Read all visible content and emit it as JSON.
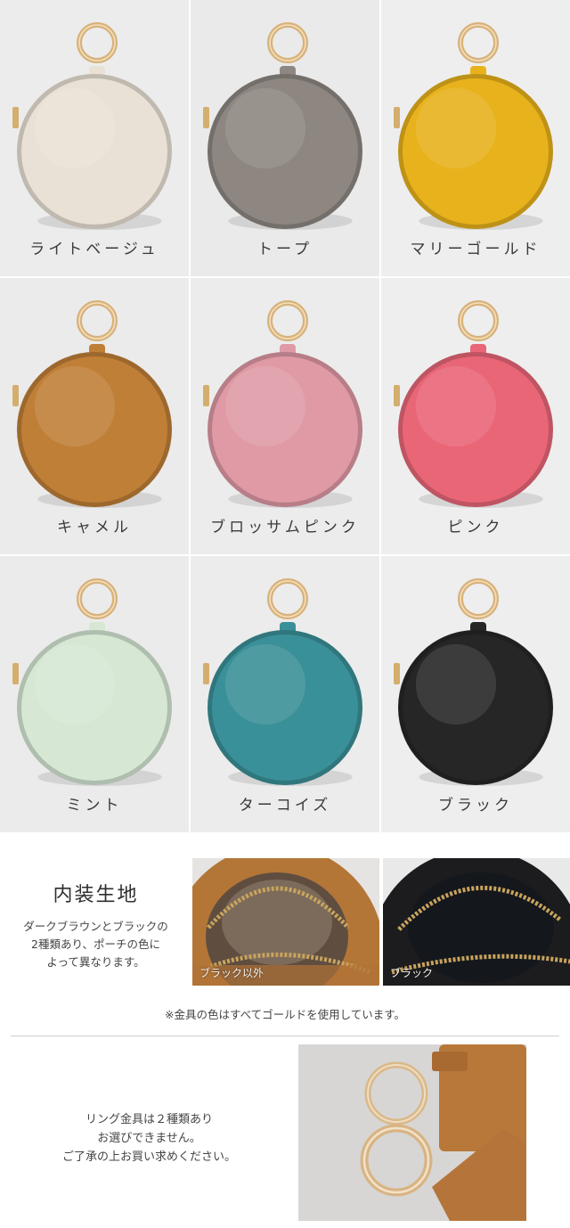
{
  "colors": [
    {
      "label": "ライトベージュ",
      "hex": "#e9e1d5",
      "bg": "#ececec"
    },
    {
      "label": "トープ",
      "hex": "#8e8781",
      "bg": "#eaeaea"
    },
    {
      "label": "マリーゴールド",
      "hex": "#e8b21c",
      "bg": "#eeeeee"
    },
    {
      "label": "キャメル",
      "hex": "#c07f37",
      "bg": "#ebebeb"
    },
    {
      "label": "ブロッサムピンク",
      "hex": "#df9aa6",
      "bg": "#ececec"
    },
    {
      "label": "ピンク",
      "hex": "#e96677",
      "bg": "#eeeeee"
    },
    {
      "label": "ミント",
      "hex": "#d6e8d4",
      "bg": "#ebebeb"
    },
    {
      "label": "ターコイズ",
      "hex": "#3a9098",
      "bg": "#ececec"
    },
    {
      "label": "ブラック",
      "hex": "#262626",
      "bg": "#eeeeee"
    }
  ],
  "lining": {
    "title": "内装生地",
    "desc": [
      "ダークブラウンとブラックの",
      "2種類あり、ポーチの色に",
      "よって異なります。"
    ],
    "photo1_caption": "ブラック以外",
    "photo2_caption": "ブラック"
  },
  "notice": "※金具の色はすべてゴールドを使用しています。",
  "ring": {
    "desc": [
      "リング金具は２種類あり",
      "お選びできません。",
      "ご了承の上お買い求めください。"
    ]
  }
}
